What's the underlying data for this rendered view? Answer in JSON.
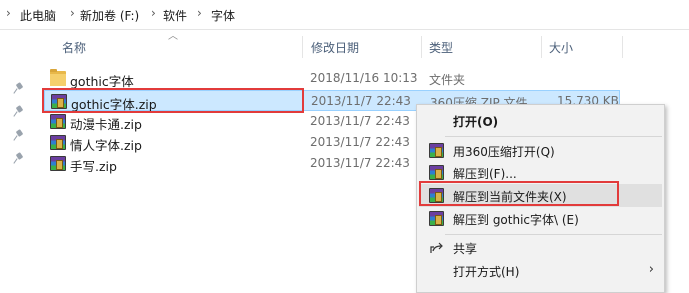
{
  "breadcrumb": {
    "items": [
      "此电脑",
      "新加卷 (F:)",
      "软件",
      "字体"
    ],
    "separator": "›"
  },
  "columns": {
    "name": "名称",
    "date": "修改日期",
    "type": "类型",
    "size": "大小"
  },
  "files": [
    {
      "name": "gothic字体",
      "date": "2018/11/16 10:13",
      "type": "文件夹",
      "size": "",
      "icon": "folder-icon"
    },
    {
      "name": "gothic字体.zip",
      "date": "2013/11/7 22:43",
      "type": "360压缩 ZIP 文件",
      "size": "15,730 KB",
      "icon": "zip-icon",
      "selected": true
    },
    {
      "name": "动漫卡通.zip",
      "date": "2013/11/7 22:43",
      "type": "",
      "size": "",
      "icon": "zip-icon"
    },
    {
      "name": "情人字体.zip",
      "date": "2013/11/7 22:43",
      "type": "",
      "size": "",
      "icon": "zip-icon"
    },
    {
      "name": "手写.zip",
      "date": "2013/11/7 22:43",
      "type": "",
      "size": "",
      "icon": "zip-icon"
    }
  ],
  "context_menu": {
    "open": "打开(O)",
    "open_360": "用360压缩打开(Q)",
    "extract_to": "解压到(F)...",
    "extract_here": "解压到当前文件夹(X)",
    "extract_folder": "解压到 gothic字体\\ (E)",
    "share": "共享",
    "open_with": "打开方式(H)"
  },
  "colors": {
    "selection": "#cce8ff",
    "highlight_box": "#e23b3b",
    "menu_bg": "#f2f2f2"
  }
}
